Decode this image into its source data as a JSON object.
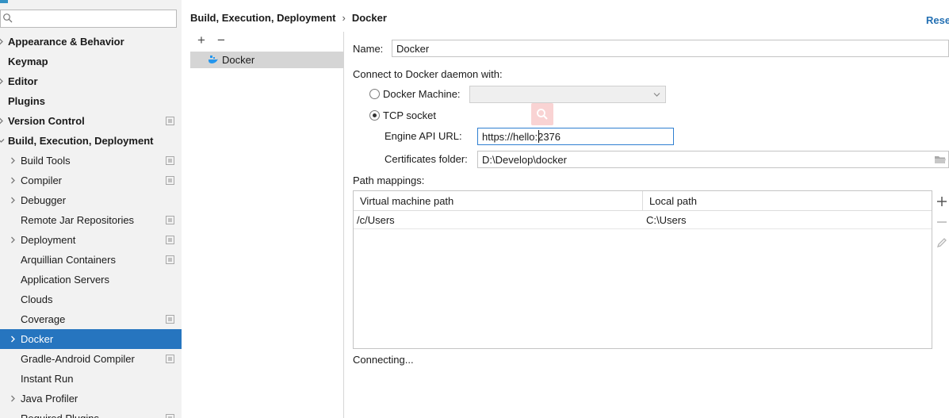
{
  "search": {
    "value": "",
    "placeholder": ""
  },
  "tree": {
    "items": [
      {
        "label": "Appearance & Behavior",
        "bold": true,
        "indent": 0,
        "expandable": true,
        "project": false
      },
      {
        "label": "Keymap",
        "bold": true,
        "indent": 0,
        "expandable": false,
        "project": false
      },
      {
        "label": "Editor",
        "bold": true,
        "indent": 0,
        "expandable": true,
        "project": false
      },
      {
        "label": "Plugins",
        "bold": true,
        "indent": 0,
        "expandable": false,
        "project": false
      },
      {
        "label": "Version Control",
        "bold": true,
        "indent": 0,
        "expandable": true,
        "project": true
      },
      {
        "label": "Build, Execution, Deployment",
        "bold": true,
        "indent": 0,
        "expandable": true,
        "expanded": true,
        "project": false
      },
      {
        "label": "Build Tools",
        "bold": false,
        "indent": 1,
        "expandable": true,
        "project": true
      },
      {
        "label": "Compiler",
        "bold": false,
        "indent": 1,
        "expandable": true,
        "project": true
      },
      {
        "label": "Debugger",
        "bold": false,
        "indent": 1,
        "expandable": true,
        "project": false
      },
      {
        "label": "Remote Jar Repositories",
        "bold": false,
        "indent": 1,
        "expandable": false,
        "project": true
      },
      {
        "label": "Deployment",
        "bold": false,
        "indent": 1,
        "expandable": true,
        "project": true
      },
      {
        "label": "Arquillian Containers",
        "bold": false,
        "indent": 1,
        "expandable": false,
        "project": true
      },
      {
        "label": "Application Servers",
        "bold": false,
        "indent": 1,
        "expandable": false,
        "project": false
      },
      {
        "label": "Clouds",
        "bold": false,
        "indent": 1,
        "expandable": false,
        "project": false
      },
      {
        "label": "Coverage",
        "bold": false,
        "indent": 1,
        "expandable": false,
        "project": true
      },
      {
        "label": "Docker",
        "bold": false,
        "indent": 1,
        "expandable": true,
        "project": false,
        "selected": true
      },
      {
        "label": "Gradle-Android Compiler",
        "bold": false,
        "indent": 1,
        "expandable": false,
        "project": true
      },
      {
        "label": "Instant Run",
        "bold": false,
        "indent": 1,
        "expandable": false,
        "project": false
      },
      {
        "label": "Java Profiler",
        "bold": false,
        "indent": 1,
        "expandable": true,
        "project": false
      },
      {
        "label": "Required Plugins",
        "bold": false,
        "indent": 1,
        "expandable": false,
        "project": true
      }
    ]
  },
  "breadcrumb": {
    "parent": "Build, Execution, Deployment",
    "separator": "›",
    "current": "Docker"
  },
  "reset_label": "Reset",
  "mid": {
    "add_label": "+",
    "remove_label": "−",
    "items": [
      {
        "label": "Docker"
      }
    ]
  },
  "form": {
    "name_label": "Name:",
    "name_value": "Docker",
    "connect_label": "Connect to Docker daemon with:",
    "docker_machine_label": "Docker Machine:",
    "docker_machine_value": "",
    "tcp_label": "TCP socket",
    "tcp_selected": true,
    "engine_label": "Engine API URL:",
    "engine_value": "https://hello:2376",
    "cert_label": "Certificates folder:",
    "cert_value": "D:\\Develop\\docker",
    "path_mappings_label": "Path mappings:"
  },
  "table": {
    "columns": [
      "Virtual machine path",
      "Local path"
    ],
    "rows": [
      [
        "/c/Users",
        "C:\\Users"
      ]
    ]
  },
  "status_text": "Connecting...",
  "colors": {
    "selection": "#2675bf",
    "accent_link": "#2470b3",
    "focus_border": "#2f7fd1",
    "tree_bg": "#f2f2f2"
  }
}
